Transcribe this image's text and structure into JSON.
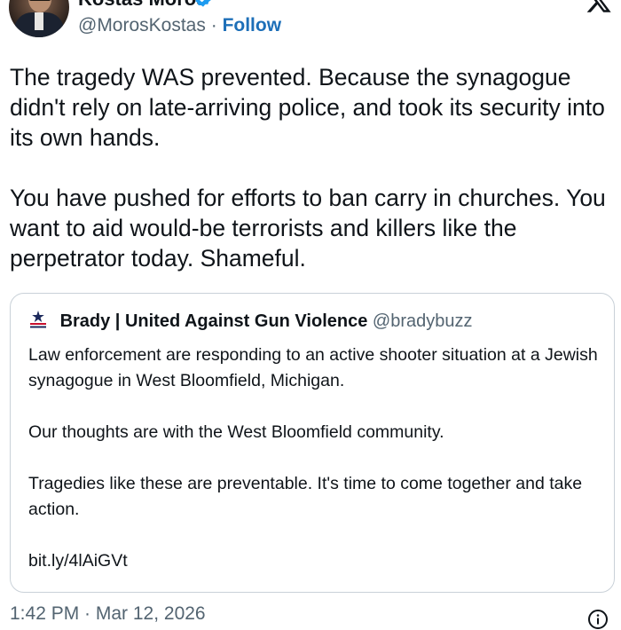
{
  "author": {
    "display_name": "Kostas Moros",
    "handle": "@MorosKostas",
    "separator": "·",
    "follow_label": "Follow",
    "verified": true,
    "avatar_icon": "avatar-photo"
  },
  "tweet": {
    "paragraphs": [
      "The tragedy WAS prevented. Because the synagogue didn't rely on late-arriving police, and took its security into its own hands.",
      "You have pushed for efforts to ban carry in churches. You want to aid would-be terrorists and killers like the perpetrator today. Shameful."
    ]
  },
  "quote": {
    "name": "Brady | United Against Gun Violence",
    "handle": "@bradybuzz",
    "paragraphs": [
      "Law enforcement are responding to an active shooter situation at a Jewish synagogue in West Bloomfield, Michigan.",
      "Our thoughts are with the West Bloomfield community.",
      "Tragedies like these are preventable. It's time to come together and take action."
    ],
    "link": "bit.ly/4lAiGVt",
    "logo_icon": "brady-logo-icon",
    "logo_colors": [
      "#1d2a5c",
      "#c8102e"
    ]
  },
  "footer": {
    "timestamp": "1:42 PM · Mar 12, 2026"
  },
  "icons": {
    "close": "x-logo-icon",
    "verified": "verified-badge-icon",
    "info": "info-icon"
  },
  "colors": {
    "accent": "#1d9bf0",
    "follow": "#1d6fb8",
    "muted": "#536471",
    "text": "#0f1419",
    "card_border": "#c9d1d8"
  }
}
